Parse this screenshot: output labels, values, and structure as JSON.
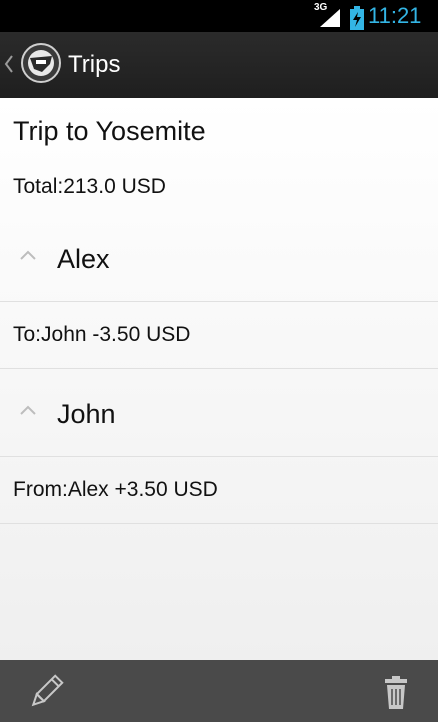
{
  "status_bar": {
    "network": "3G",
    "time": "11:21"
  },
  "action_bar": {
    "title": "Trips",
    "up_icon": "chevron-left-icon",
    "app_icon": "app-logo-icon"
  },
  "trip": {
    "name": "Trip to Yosemite",
    "total": "Total:213.0 USD"
  },
  "people": [
    {
      "name": "Alex",
      "balance": "To:John -3.50 USD"
    },
    {
      "name": "John",
      "balance": "From:Alex +3.50 USD"
    }
  ],
  "bottom_bar": {
    "edit_icon": "pencil-icon",
    "delete_icon": "trash-icon"
  },
  "colors": {
    "clock": "#33b5e5",
    "action_bar": "#2b2b2b",
    "bottom_bar": "#4a4a4a"
  }
}
